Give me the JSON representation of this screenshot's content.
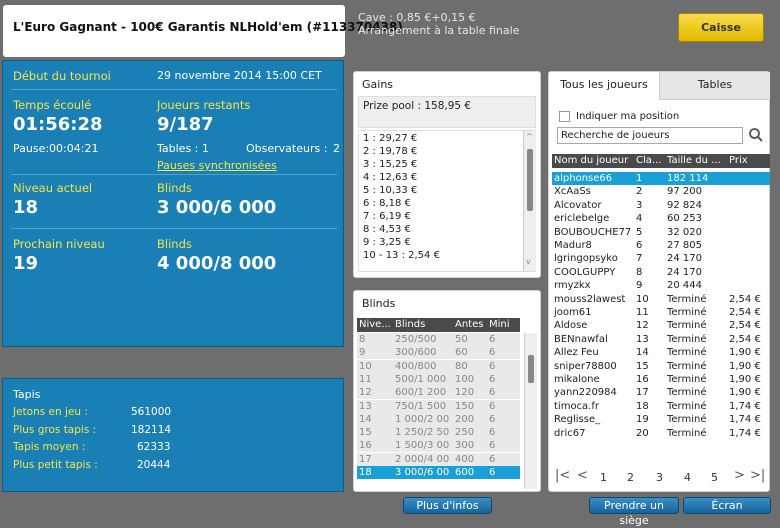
{
  "tournament": {
    "title": "L'Euro Gagnant - 100€ Garantis NLHold'em (#113370438)",
    "start_label": "Début du tournoi",
    "start_value": "29 novembre 2014  15:00 CET",
    "elapsed_label": "Temps écoulé",
    "elapsed_value": "01:56:28",
    "pause_label": "Pause:00:04:21",
    "remaining_label": "Joueurs restants",
    "remaining_value": "9/187",
    "tables_label": "Tables : 1",
    "observers_label": "Observateurs :",
    "observers_value": "2",
    "sync_pause_link": "Pauses synchronisées",
    "level_label": "Niveau actuel",
    "level_value": "18",
    "blinds_label": "Blinds",
    "blinds_value": "3 000/6 000",
    "next_level_label": "Prochain niveau",
    "next_level_value": "19",
    "next_blinds_label": "Blinds",
    "next_blinds_value": "4 000/8 000"
  },
  "stacks": {
    "title": "Tapis",
    "rows": [
      {
        "label": "Jetons en jeu :",
        "value": "561000"
      },
      {
        "label": "Plus gros tapis :",
        "value": "182114"
      },
      {
        "label": "Tapis moyen :",
        "value": "62333"
      },
      {
        "label": "Plus petit tapis :",
        "value": "20444"
      }
    ]
  },
  "cashier": {
    "line1": "Cave : 0,85 €+0,15 €",
    "line2": "Arrangement à la table finale",
    "button": "Caisse"
  },
  "gains": {
    "title": "Gains",
    "prize_pool": "Prize pool : 158,95 €",
    "rows": [
      "1 : 29,27 €",
      "2 : 19,78 €",
      "3 : 15,25 €",
      "4 : 12,63 €",
      "5 : 10,33 €",
      "6 : 8,18 €",
      "7 : 6,19 €",
      "8 : 4,53 €",
      "9 : 3,25 €",
      "10 - 13 : 2,54 €"
    ]
  },
  "blinds": {
    "title": "Blinds",
    "headers": [
      "Nive...",
      "Blinds",
      "Antes",
      "Mini"
    ],
    "rows": [
      [
        "8",
        "250/500",
        "50",
        "6"
      ],
      [
        "9",
        "300/600",
        "60",
        "6"
      ],
      [
        "10",
        "400/800",
        "80",
        "6"
      ],
      [
        "11",
        "500/1 000",
        "100",
        "6"
      ],
      [
        "12",
        "600/1 200",
        "120",
        "6"
      ],
      [
        "13",
        "750/1 500",
        "150",
        "6"
      ],
      [
        "14",
        "1 000/2 00",
        "200",
        "6"
      ],
      [
        "15",
        "1 250/2 50",
        "250",
        "6"
      ],
      [
        "16",
        "1 500/3 00",
        "300",
        "6"
      ],
      [
        "17",
        "2 000/4 00",
        "400",
        "6"
      ],
      [
        "18",
        "3 000/6 00",
        "600",
        "6"
      ]
    ],
    "more_info_button": "Plus d'infos"
  },
  "players": {
    "tabs": [
      "Tous les joueurs",
      "Tables"
    ],
    "position_checkbox_label": "Indiquer ma position",
    "search_placeholder": "Recherche de joueurs",
    "headers": [
      "Nom du joueur",
      "Cla...",
      "Taille du ...",
      "Prix"
    ],
    "rows": [
      [
        "alphonse66",
        "1",
        "182 114",
        ""
      ],
      [
        "XcAaSs",
        "2",
        "97 200",
        ""
      ],
      [
        "Alcovator",
        "3",
        "92 824",
        ""
      ],
      [
        "ericlebelge",
        "4",
        "60 253",
        ""
      ],
      [
        "BOUBOUCHE77",
        "5",
        "32 020",
        ""
      ],
      [
        "Madur8",
        "6",
        "27 805",
        ""
      ],
      [
        "lgringopsyko",
        "7",
        "24 170",
        ""
      ],
      [
        "COOLGUPPY",
        "8",
        "24 170",
        ""
      ],
      [
        "rmyzkx",
        "9",
        "20 444",
        ""
      ],
      [
        "mouss2lawest",
        "10",
        "Terminé",
        "2,54 €"
      ],
      [
        "joom61",
        "11",
        "Terminé",
        "2,54 €"
      ],
      [
        "Aldose",
        "12",
        "Terminé",
        "2,54 €"
      ],
      [
        "BENnawfal",
        "13",
        "Terminé",
        "2,54 €"
      ],
      [
        "Allez Feu",
        "14",
        "Terminé",
        "1,90 €"
      ],
      [
        "sniper78800",
        "15",
        "Terminé",
        "1,90 €"
      ],
      [
        "mikalone",
        "16",
        "Terminé",
        "1,90 €"
      ],
      [
        "yann220984",
        "17",
        "Terminé",
        "1,90 €"
      ],
      [
        "timoca.fr",
        "18",
        "Terminé",
        "1,74 €"
      ],
      [
        "Reglisse_",
        "19",
        "Terminé",
        "1,74 €"
      ],
      [
        "dric67",
        "20",
        "Terminé",
        "1,74 €"
      ]
    ],
    "pages": [
      "1",
      "2",
      "3",
      "4",
      "5"
    ],
    "nav": {
      "first": "|<",
      "prev": "<",
      "next": ">",
      "last": ">|"
    }
  },
  "footer": {
    "take_seat": "Prendre un siège",
    "screen": "Écran"
  },
  "colors": {
    "accent": "#1a7fb5",
    "highlight": "#f4e64a",
    "selected_row": "#1a9fd6",
    "caisse": "#f2cc1c"
  }
}
